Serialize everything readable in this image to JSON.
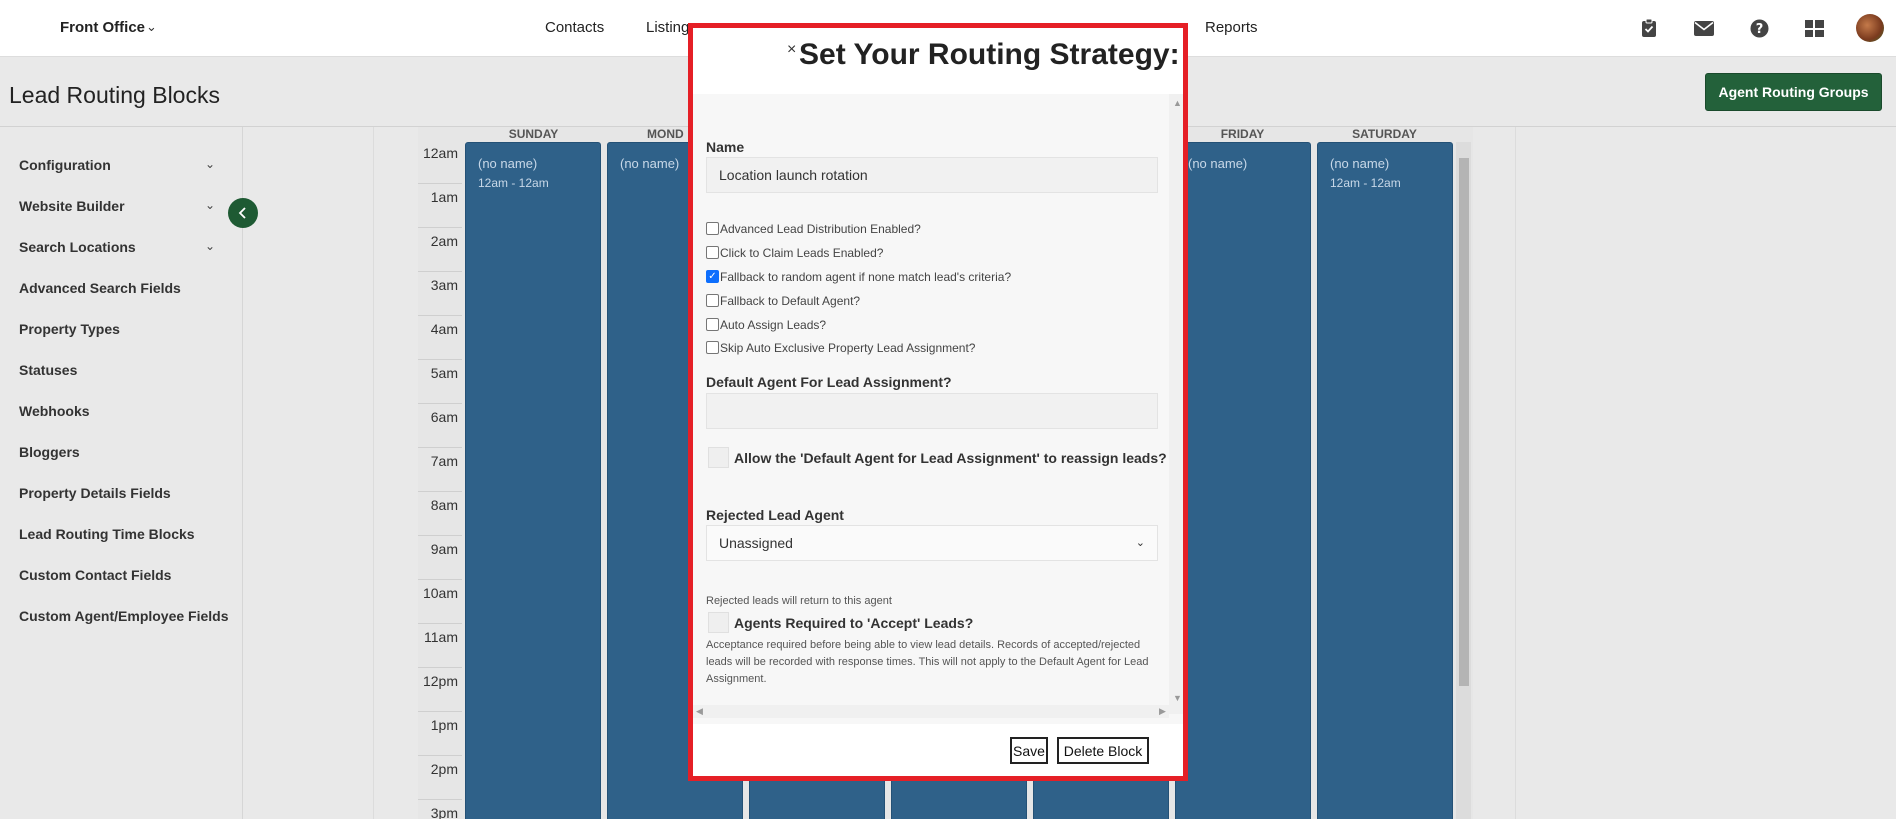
{
  "topbar": {
    "brand": "Front Office",
    "nav": [
      "Contacts",
      "Listing",
      "Reports"
    ],
    "icons": [
      "clipboard-check-icon",
      "mail-icon",
      "help-icon",
      "dashboard-grid-icon",
      "user-avatar"
    ]
  },
  "page": {
    "title": "Lead Routing Blocks",
    "routing_button": "Agent Routing Groups"
  },
  "sidebar": {
    "items": [
      {
        "label": "Configuration",
        "has_chevron": true
      },
      {
        "label": "Website Builder",
        "has_chevron": true
      },
      {
        "label": "Search Locations",
        "has_chevron": true
      },
      {
        "label": "Advanced Search Fields",
        "has_chevron": false
      },
      {
        "label": "Property Types",
        "has_chevron": false
      },
      {
        "label": "Statuses",
        "has_chevron": false
      },
      {
        "label": "Webhooks",
        "has_chevron": false
      },
      {
        "label": "Bloggers",
        "has_chevron": false
      },
      {
        "label": "Property Details Fields",
        "has_chevron": false
      },
      {
        "label": "Lead Routing Time Blocks",
        "has_chevron": false
      },
      {
        "label": "Custom Contact Fields",
        "has_chevron": false
      },
      {
        "label": "Custom Agent/Employee Fields",
        "has_chevron": false
      }
    ]
  },
  "calendar": {
    "days": [
      "SUNDAY",
      "MOND",
      "FRIDAY",
      "SATURDAY"
    ],
    "hours": [
      "12am",
      "1am",
      "2am",
      "3am",
      "4am",
      "5am",
      "6am",
      "7am",
      "8am",
      "9am",
      "10am",
      "11am",
      "12pm",
      "1pm",
      "2pm",
      "3pm"
    ],
    "blocks": [
      {
        "name": "(no name)",
        "time": "12am - 12am"
      },
      {
        "name": "(no name)",
        "time": ""
      },
      {
        "name": "(no name)",
        "time": ""
      },
      {
        "name": "(no name)",
        "time": "12am - 12am"
      }
    ]
  },
  "modal": {
    "close": "×",
    "title": "Set Your Routing Strategy:",
    "name_label": "Name",
    "name_value": "Location launch rotation",
    "checkboxes": [
      {
        "label": "Advanced Lead Distribution Enabled?",
        "checked": false
      },
      {
        "label": "Click to Claim Leads Enabled?",
        "checked": false
      },
      {
        "label": "Fallback to random agent if none match lead's criteria?",
        "checked": true
      },
      {
        "label": "Fallback to Default Agent?",
        "checked": false
      },
      {
        "label": "Auto Assign Leads?",
        "checked": false
      },
      {
        "label": "Skip Auto Exclusive Property Lead Assignment?",
        "checked": false
      }
    ],
    "default_agent_label": "Default Agent For Lead Assignment?",
    "default_agent_value": "",
    "allow_reassign_label": "Allow the 'Default Agent for Lead Assignment' to reassign leads?",
    "rejected_label": "Rejected Lead Agent",
    "rejected_value": "Unassigned",
    "rejected_note": "Rejected leads will return to this agent",
    "accept_label": "Agents Required to 'Accept' Leads?",
    "accept_note": "Acceptance required before being able to view lead details. Records of accepted/rejected leads will be recorded with response times. This will not apply to the Default Agent for Lead Assignment.",
    "save": "Save",
    "delete": "Delete Block"
  }
}
